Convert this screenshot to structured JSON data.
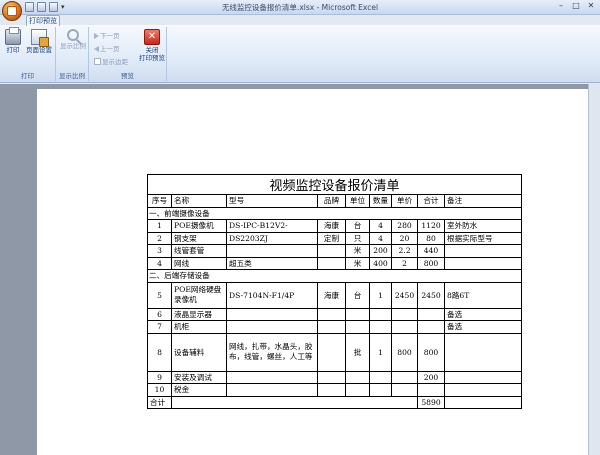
{
  "window": {
    "title": "无线监控设备报价清单.xlsx - Microsoft Excel",
    "tab_label": "打印预览",
    "controls": [
      "–",
      "□",
      "✕"
    ]
  },
  "ribbon": {
    "groups": [
      {
        "label": "打印",
        "buttons": [
          {
            "label": "打印",
            "icon": "printer-icon"
          },
          {
            "label": "页面设置",
            "icon": "page-setup-icon"
          }
        ]
      },
      {
        "label": "显示比例",
        "buttons": [
          {
            "label": "显示比例",
            "icon": "zoom-icon",
            "disabled": true
          }
        ]
      },
      {
        "label": "预览",
        "buttons": [
          {
            "label": "下一页",
            "icon": "next-page-icon",
            "disabled": true
          },
          {
            "label": "上一页",
            "icon": "prev-page-icon",
            "disabled": true
          },
          {
            "label": "显示边距",
            "icon": "checkbox-icon",
            "disabled": true
          },
          {
            "label": "关闭",
            "label2": "打印预览",
            "icon": "close-preview-icon"
          }
        ]
      }
    ]
  },
  "sheet": {
    "title": "视频监控设备报价清单",
    "headers": [
      "序号",
      "名称",
      "型号",
      "品牌",
      "单位",
      "数量",
      "单价",
      "合计",
      "备注"
    ],
    "section1": "一、前端摄像设备",
    "rows1": [
      [
        "1",
        "POE摄像机",
        "DS-IPC-B12V2-",
        "海康",
        "台",
        "4",
        "280",
        "1120",
        "室外防水"
      ],
      [
        "2",
        "钢支架",
        "DS2203ZJ",
        "定制",
        "只",
        "4",
        "20",
        "80",
        "根据实际型号"
      ],
      [
        "3",
        "线管套管",
        "",
        "",
        "米",
        "200",
        "2.2",
        "440",
        ""
      ],
      [
        "4",
        "网线",
        "超五类",
        "",
        "米",
        "400",
        "2",
        "800",
        ""
      ]
    ],
    "section2": "二、后端存储设备",
    "rows2": [
      [
        "5",
        "POE网络硬盘录像机",
        "DS-7104N-F1/4P",
        "海康",
        "台",
        "1",
        "2450",
        "2450",
        "8路6T"
      ],
      [
        "6",
        "液晶显示器",
        "",
        "",
        "",
        "",
        "",
        "",
        "备选"
      ],
      [
        "7",
        "机柜",
        "",
        "",
        "",
        "",
        "",
        "",
        "备选"
      ],
      [
        "8",
        "设备辅料",
        "网线，扎带，水晶头，胶布，线管，螺丝，人工等",
        "",
        "批",
        "1",
        "800",
        "800",
        ""
      ],
      [
        "9",
        "安装及调试",
        "",
        "",
        "",
        "",
        "",
        "200",
        ""
      ],
      [
        "10",
        "税金",
        "",
        "",
        "",
        "",
        "",
        "",
        ""
      ]
    ],
    "total_label": "合计",
    "total_value": "5890"
  }
}
